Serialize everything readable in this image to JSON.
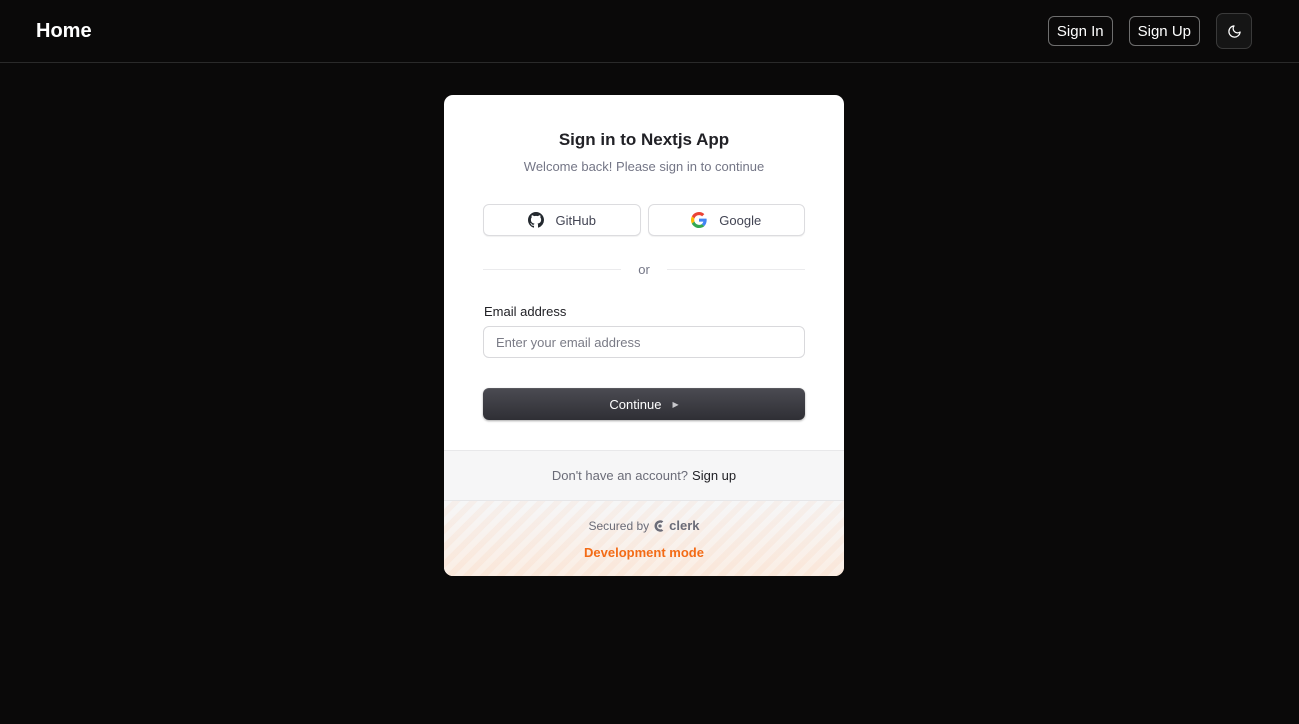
{
  "nav": {
    "brand": "Home",
    "sign_in": "Sign In",
    "sign_up": "Sign Up",
    "theme_icon": "moon-icon"
  },
  "signin": {
    "title": "Sign in to Nextjs App",
    "subtitle": "Welcome back! Please sign in to continue",
    "providers": [
      {
        "label": "GitHub",
        "icon": "github-icon"
      },
      {
        "label": "Google",
        "icon": "google-icon"
      }
    ],
    "divider_text": "or",
    "email_label": "Email address",
    "email_placeholder": "Enter your email address",
    "email_value": "",
    "continue_label": "Continue",
    "signup_prompt": "Don't have an account?",
    "signup_link": "Sign up",
    "secured_by": "Secured by",
    "secured_brand": "clerk",
    "dev_mode": "Development mode"
  },
  "colors": {
    "page_bg": "#0a0909",
    "card_bg": "#ffffff",
    "primary_button": "#2f2f35",
    "dev_mode_accent": "#f36b16"
  }
}
